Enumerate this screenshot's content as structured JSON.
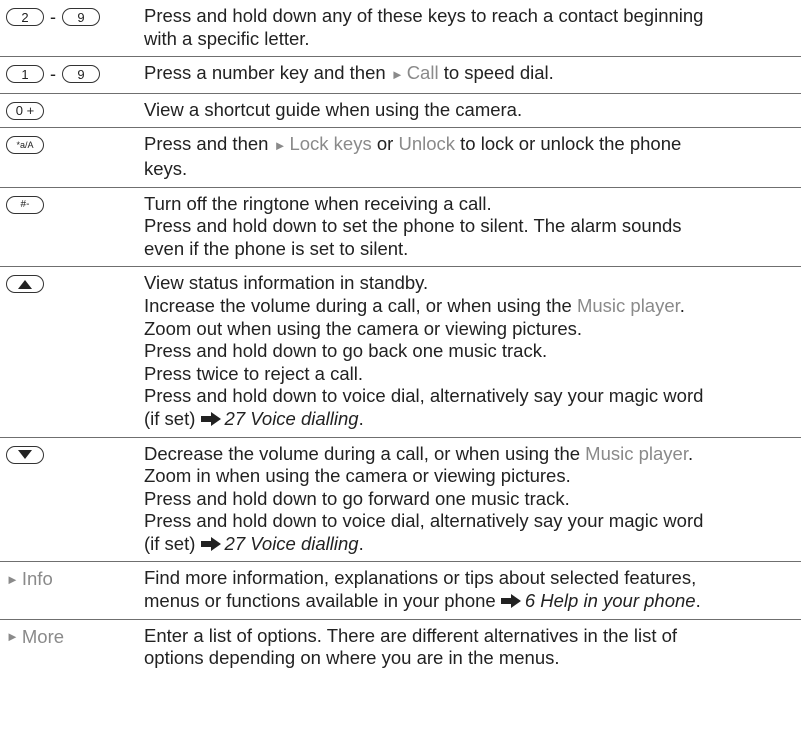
{
  "rows": [
    {
      "keys": {
        "a": "2",
        "sep": "-",
        "b": "9"
      },
      "lines": [
        "Press and hold down any of these keys to reach a contact beginning",
        "with a specific letter."
      ]
    },
    {
      "keys": {
        "a": "1",
        "sep": "-",
        "b": "9"
      },
      "pre": "Press a number key and then ",
      "hl": "Call",
      "post": " to speed dial."
    },
    {
      "key": "0 +",
      "lines": [
        "View a shortcut guide when using the camera."
      ]
    },
    {
      "key": "*a/A",
      "l1_pre": "Press and then ",
      "l1_hl1": "Lock keys",
      "l1_mid": " or ",
      "l1_hl2": "Unlock",
      "l1_post": " to lock or unlock the phone",
      "l2": "keys."
    },
    {
      "key": "#-",
      "lines": [
        "Turn off the ringtone when receiving a call.",
        "Press and hold down to set the phone to silent. The alarm sounds",
        "even if the phone is set to silent."
      ]
    },
    {
      "key": "up-arrow",
      "l1": "View status information in standby.",
      "l2_pre": "Increase the volume during a call, or when using the ",
      "l2_hl": "Music player",
      "l2_post": ".",
      "l3": "Zoom out when using the camera or viewing pictures.",
      "l4": "Press and hold down to go back one music track.",
      "l5": "Press twice to reject a call.",
      "l6": "Press and hold down to voice dial, alternatively say your magic word",
      "l7_pre": "(if set) ",
      "l7_ref": "27 Voice dialling",
      "l7_post": "."
    },
    {
      "key": "down-arrow",
      "l1_pre": "Decrease the volume during a call, or when using the ",
      "l1_hl": "Music player",
      "l1_post": ".",
      "l2": "Zoom in when using the camera or viewing pictures.",
      "l3": "Press and hold down to go forward one music track.",
      "l4": "Press and hold down to voice dial, alternatively say your magic word",
      "l5_pre": "(if set) ",
      "l5_ref": "27 Voice dialling",
      "l5_post": "."
    },
    {
      "label": "Info",
      "l1": "Find more information, explanations or tips about selected features,",
      "l2_pre": "menus or functions available in your phone ",
      "l2_ref": "6 Help in your phone",
      "l2_post": "."
    },
    {
      "label": "More",
      "lines": [
        "Enter a list of options. There are different alternatives in the list of",
        "options depending on where you are in the menus."
      ]
    }
  ],
  "symbols": {
    "triangle": "►"
  },
  "colors": {
    "highlight": "#8a8a8a",
    "text": "#222222",
    "rule": "#6f6f6f"
  },
  "icons": [
    "arrow-right-icon",
    "up-arrow-key-icon",
    "down-arrow-key-icon"
  ]
}
